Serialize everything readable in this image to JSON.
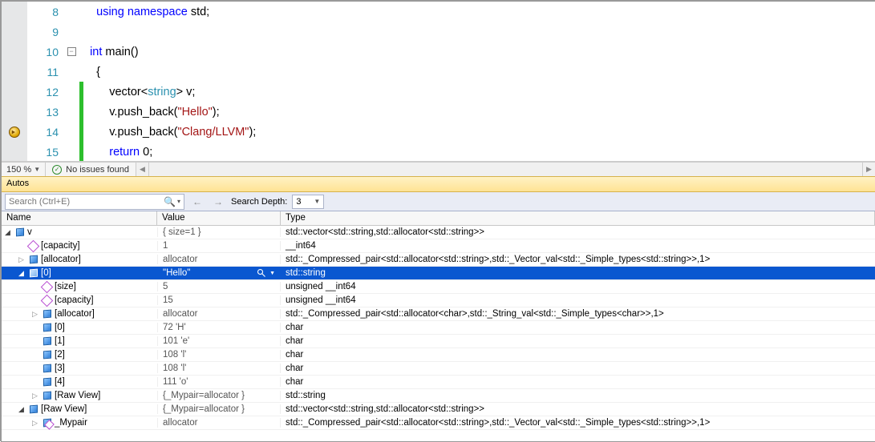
{
  "editor": {
    "lines": [
      {
        "num": 8,
        "bp": false,
        "fold": null,
        "changed": false,
        "code_html": "    <span class='kw'>using</span> <span class='kw'>namespace</span> <span class='ident'>std</span>;"
      },
      {
        "num": 9,
        "bp": false,
        "fold": null,
        "changed": false,
        "code_html": ""
      },
      {
        "num": 10,
        "bp": false,
        "fold": "open",
        "changed": false,
        "code_html": "  <span class='kw'>int</span> <span class='ident'>main</span>()"
      },
      {
        "num": 11,
        "bp": false,
        "fold": "line",
        "changed": false,
        "code_html": "    {"
      },
      {
        "num": 12,
        "bp": false,
        "fold": "line",
        "changed": true,
        "code_html": "        <span class='ident'>vector</span>&lt;<span class='type'>string</span>&gt; <span class='ident'>v</span>;"
      },
      {
        "num": 13,
        "bp": false,
        "fold": "line",
        "changed": true,
        "code_html": "        <span class='ident'>v</span>.<span class='ident'>push_back</span>(<span class='str'>\"Hello\"</span>);"
      },
      {
        "num": 14,
        "bp": true,
        "fold": "line",
        "changed": true,
        "code_html": "        <span class='ident'>v</span>.<span class='ident'>push_back</span>(<span class='str'>\"Clang/LLVM\"</span>);"
      },
      {
        "num": 15,
        "bp": false,
        "fold": "line",
        "changed": true,
        "code_html": "        <span class='kw'>return</span> <span class='op'>0</span>;"
      }
    ]
  },
  "footer": {
    "zoom": "150 %",
    "status": "No issues found"
  },
  "panes": {
    "autos_title": "Autos"
  },
  "search": {
    "placeholder": "Search (Ctrl+E)",
    "depth_label": "Search Depth:",
    "depth_value": "3"
  },
  "grid": {
    "headers": {
      "name": "Name",
      "value": "Value",
      "type": "Type"
    },
    "rows": [
      {
        "depth": 0,
        "exp": "open",
        "icon": "cube",
        "name": "v",
        "value": "{ size=1 }",
        "type": "std::vector<std::string,std::allocator<std::string>>",
        "sel": false
      },
      {
        "depth": 1,
        "exp": "none",
        "icon": "hex",
        "name": "[capacity]",
        "value": "1",
        "type": "__int64",
        "sel": false
      },
      {
        "depth": 1,
        "exp": "closed",
        "icon": "cube",
        "name": "[allocator]",
        "value": "allocator",
        "type": "std::_Compressed_pair<std::allocator<std::string>,std::_Vector_val<std::_Simple_types<std::string>>,1>",
        "sel": false
      },
      {
        "depth": 1,
        "exp": "open",
        "icon": "cube",
        "name": "[0]",
        "value": "\"Hello\"",
        "type": "std::string",
        "sel": true,
        "viz": true
      },
      {
        "depth": 2,
        "exp": "none",
        "icon": "hex",
        "name": "[size]",
        "value": "5",
        "type": "unsigned __int64",
        "sel": false
      },
      {
        "depth": 2,
        "exp": "none",
        "icon": "hex",
        "name": "[capacity]",
        "value": "15",
        "type": "unsigned __int64",
        "sel": false
      },
      {
        "depth": 2,
        "exp": "closed",
        "icon": "cube",
        "name": "[allocator]",
        "value": "allocator",
        "type": "std::_Compressed_pair<std::allocator<char>,std::_String_val<std::_Simple_types<char>>,1>",
        "sel": false
      },
      {
        "depth": 2,
        "exp": "none",
        "icon": "cube",
        "name": "[0]",
        "value": "72 'H'",
        "type": "char",
        "sel": false
      },
      {
        "depth": 2,
        "exp": "none",
        "icon": "cube",
        "name": "[1]",
        "value": "101 'e'",
        "type": "char",
        "sel": false
      },
      {
        "depth": 2,
        "exp": "none",
        "icon": "cube",
        "name": "[2]",
        "value": "108 'l'",
        "type": "char",
        "sel": false
      },
      {
        "depth": 2,
        "exp": "none",
        "icon": "cube",
        "name": "[3]",
        "value": "108 'l'",
        "type": "char",
        "sel": false
      },
      {
        "depth": 2,
        "exp": "none",
        "icon": "cube",
        "name": "[4]",
        "value": "111 'o'",
        "type": "char",
        "sel": false
      },
      {
        "depth": 2,
        "exp": "closed",
        "icon": "cube",
        "name": "[Raw View]",
        "value": "{_Mypair=allocator }",
        "type": "std::string",
        "sel": false
      },
      {
        "depth": 1,
        "exp": "open",
        "icon": "cube",
        "name": "[Raw View]",
        "value": "{_Mypair=allocator }",
        "type": "std::vector<std::string,std::allocator<std::string>>",
        "sel": false
      },
      {
        "depth": 2,
        "exp": "closed",
        "icon": "cube-p",
        "name": "_Mypair",
        "value": "allocator",
        "type": "std::_Compressed_pair<std::allocator<std::string>,std::_Vector_val<std::_Simple_types<std::string>>,1>",
        "sel": false
      }
    ]
  }
}
